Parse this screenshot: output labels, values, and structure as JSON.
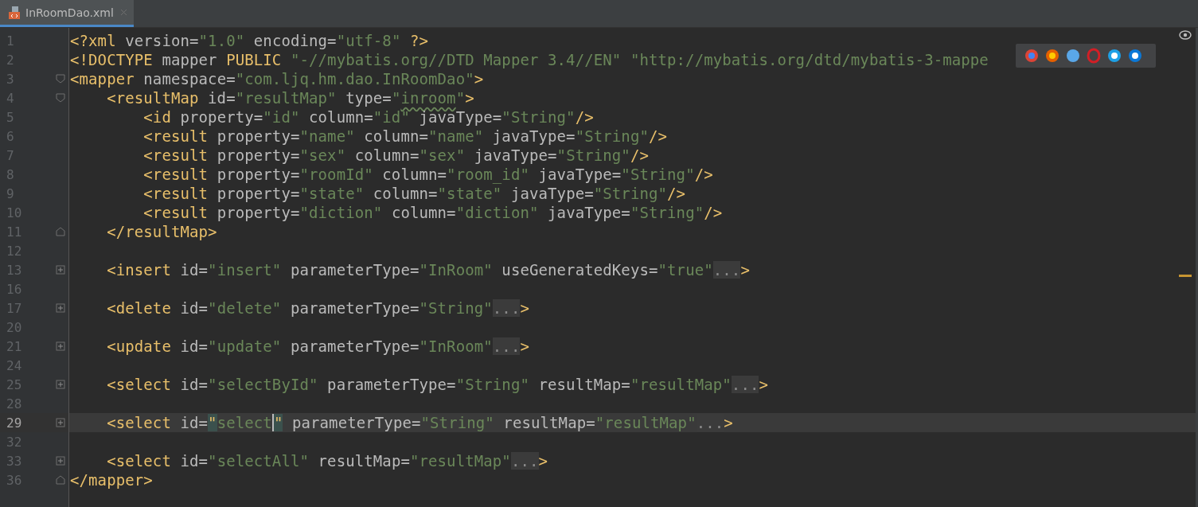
{
  "tabs": [
    {
      "label": "InRoomDao.xml",
      "selected": true
    }
  ],
  "lines": [
    {
      "number": "1",
      "kind": "plain",
      "current": false,
      "tokens": [
        {
          "kind": "tag",
          "text": "<?xml"
        },
        {
          "kind": "attr",
          "text": " version="
        },
        {
          "kind": "value",
          "text": "\"1.0\""
        },
        {
          "kind": "attr",
          "text": " encoding="
        },
        {
          "kind": "value",
          "text": "\"utf-8\""
        },
        {
          "kind": "tag",
          "text": " ?>"
        }
      ]
    },
    {
      "number": "2",
      "kind": "plain",
      "current": false,
      "tokens": [
        {
          "kind": "tag",
          "text": "<!DOCTYPE"
        },
        {
          "kind": "attr",
          "text": " mapper "
        },
        {
          "kind": "tag",
          "text": "PUBLIC"
        },
        {
          "kind": "value",
          "text": " \"-//mybatis.org//DTD Mapper 3.4//EN\" \"http://mybatis.org/dtd/mybatis-3-mappe"
        }
      ]
    },
    {
      "number": "3",
      "kind": "fold_start",
      "current": false,
      "tokens": [
        {
          "kind": "tag",
          "text": "<mapper"
        },
        {
          "kind": "attr",
          "text": " namespace="
        },
        {
          "kind": "value",
          "text": "\"com.ljq.hm.dao.InRoomDao\""
        },
        {
          "kind": "tag",
          "text": ">"
        }
      ]
    },
    {
      "number": "4",
      "kind": "fold_start",
      "current": false,
      "tokens": [
        {
          "kind": "tag",
          "text": "    <resultMap"
        },
        {
          "kind": "attr",
          "text": " id="
        },
        {
          "kind": "value",
          "text": "\"resultMap\""
        },
        {
          "kind": "attr",
          "text": " type="
        },
        {
          "kind": "value",
          "text": "\""
        },
        {
          "kind": "warning",
          "text": "inroom"
        },
        {
          "kind": "value",
          "text": "\""
        },
        {
          "kind": "tag",
          "text": ">"
        }
      ]
    },
    {
      "number": "5",
      "kind": "plain",
      "current": false,
      "tokens": [
        {
          "kind": "tag",
          "text": "        <id"
        },
        {
          "kind": "attr",
          "text": " property="
        },
        {
          "kind": "value",
          "text": "\"id\""
        },
        {
          "kind": "attr",
          "text": " column="
        },
        {
          "kind": "value",
          "text": "\"id\""
        },
        {
          "kind": "attr",
          "text": " javaType="
        },
        {
          "kind": "value",
          "text": "\"String\""
        },
        {
          "kind": "tag",
          "text": "/>"
        }
      ]
    },
    {
      "number": "6",
      "kind": "plain",
      "current": false,
      "tokens": [
        {
          "kind": "tag",
          "text": "        <result"
        },
        {
          "kind": "attr",
          "text": " property="
        },
        {
          "kind": "value",
          "text": "\"name\""
        },
        {
          "kind": "attr",
          "text": " column="
        },
        {
          "kind": "value",
          "text": "\"name\""
        },
        {
          "kind": "attr",
          "text": " javaType="
        },
        {
          "kind": "value",
          "text": "\"String\""
        },
        {
          "kind": "tag",
          "text": "/>"
        }
      ]
    },
    {
      "number": "7",
      "kind": "plain",
      "current": false,
      "tokens": [
        {
          "kind": "tag",
          "text": "        <result"
        },
        {
          "kind": "attr",
          "text": " property="
        },
        {
          "kind": "value",
          "text": "\"sex\""
        },
        {
          "kind": "attr",
          "text": " column="
        },
        {
          "kind": "value",
          "text": "\"sex\""
        },
        {
          "kind": "attr",
          "text": " javaType="
        },
        {
          "kind": "value",
          "text": "\"String\""
        },
        {
          "kind": "tag",
          "text": "/>"
        }
      ]
    },
    {
      "number": "8",
      "kind": "plain",
      "current": false,
      "tokens": [
        {
          "kind": "tag",
          "text": "        <result"
        },
        {
          "kind": "attr",
          "text": " property="
        },
        {
          "kind": "value",
          "text": "\"roomId\""
        },
        {
          "kind": "attr",
          "text": " column="
        },
        {
          "kind": "value",
          "text": "\"room_id\""
        },
        {
          "kind": "attr",
          "text": " javaType="
        },
        {
          "kind": "value",
          "text": "\"String\""
        },
        {
          "kind": "tag",
          "text": "/>"
        }
      ]
    },
    {
      "number": "9",
      "kind": "plain",
      "current": false,
      "tokens": [
        {
          "kind": "tag",
          "text": "        <result"
        },
        {
          "kind": "attr",
          "text": " property="
        },
        {
          "kind": "value",
          "text": "\"state\""
        },
        {
          "kind": "attr",
          "text": " column="
        },
        {
          "kind": "value",
          "text": "\"state\""
        },
        {
          "kind": "attr",
          "text": " javaType="
        },
        {
          "kind": "value",
          "text": "\"String\""
        },
        {
          "kind": "tag",
          "text": "/>"
        }
      ]
    },
    {
      "number": "10",
      "kind": "plain",
      "current": false,
      "tokens": [
        {
          "kind": "tag",
          "text": "        <result"
        },
        {
          "kind": "attr",
          "text": " property="
        },
        {
          "kind": "value",
          "text": "\"diction\""
        },
        {
          "kind": "attr",
          "text": " column="
        },
        {
          "kind": "value",
          "text": "\"diction\""
        },
        {
          "kind": "attr",
          "text": " javaType="
        },
        {
          "kind": "value",
          "text": "\"String\""
        },
        {
          "kind": "tag",
          "text": "/>"
        }
      ]
    },
    {
      "number": "11",
      "kind": "fold_end",
      "current": false,
      "tokens": [
        {
          "kind": "tag",
          "text": "    </resultMap>"
        }
      ]
    },
    {
      "number": "12",
      "kind": "plain",
      "current": false
    },
    {
      "number": "13",
      "kind": "collapsed",
      "current": false,
      "tokens": [
        {
          "kind": "tag",
          "text": "    <insert"
        },
        {
          "kind": "attr",
          "text": " id="
        },
        {
          "kind": "value",
          "text": "\"insert\""
        },
        {
          "kind": "attr",
          "text": " parameterType="
        },
        {
          "kind": "value",
          "text": "\"InRoom\""
        },
        {
          "kind": "attr",
          "text": " useGeneratedKeys="
        },
        {
          "kind": "value",
          "text": "\"true\""
        },
        {
          "kind": "folded",
          "text": "..."
        },
        {
          "kind": "tag",
          "text": ">"
        }
      ]
    },
    {
      "number": "16",
      "kind": "plain",
      "current": false
    },
    {
      "number": "17",
      "kind": "collapsed",
      "current": false,
      "tokens": [
        {
          "kind": "tag",
          "text": "    <delete"
        },
        {
          "kind": "attr",
          "text": " id="
        },
        {
          "kind": "value",
          "text": "\"delete\""
        },
        {
          "kind": "attr",
          "text": " parameterType="
        },
        {
          "kind": "value",
          "text": "\"String\""
        },
        {
          "kind": "folded",
          "text": "..."
        },
        {
          "kind": "tag",
          "text": ">"
        }
      ]
    },
    {
      "number": "20",
      "kind": "plain",
      "current": false
    },
    {
      "number": "21",
      "kind": "collapsed",
      "current": false,
      "tokens": [
        {
          "kind": "tag",
          "text": "    <update"
        },
        {
          "kind": "attr",
          "text": " id="
        },
        {
          "kind": "value",
          "text": "\"update\""
        },
        {
          "kind": "attr",
          "text": " parameterType="
        },
        {
          "kind": "value",
          "text": "\"InRoom\""
        },
        {
          "kind": "folded",
          "text": "..."
        },
        {
          "kind": "tag",
          "text": ">"
        }
      ]
    },
    {
      "number": "24",
      "kind": "plain",
      "current": false
    },
    {
      "number": "25",
      "kind": "collapsed",
      "current": false,
      "tokens": [
        {
          "kind": "tag",
          "text": "    <select"
        },
        {
          "kind": "attr",
          "text": " id="
        },
        {
          "kind": "value",
          "text": "\"selectById\""
        },
        {
          "kind": "attr",
          "text": " parameterType="
        },
        {
          "kind": "value",
          "text": "\"String\""
        },
        {
          "kind": "attr",
          "text": " resultMap="
        },
        {
          "kind": "value",
          "text": "\"resultMap\""
        },
        {
          "kind": "folded",
          "text": "..."
        },
        {
          "kind": "tag",
          "text": ">"
        }
      ]
    },
    {
      "number": "28",
      "kind": "plain",
      "current": false
    },
    {
      "number": "29",
      "kind": "collapsed",
      "current": true,
      "tokens": [
        {
          "kind": "tag",
          "text": "    <select"
        },
        {
          "kind": "attr",
          "text": " id="
        },
        {
          "kind": "match",
          "text": "\""
        },
        {
          "kind": "value",
          "text": "select"
        },
        {
          "kind": "caret",
          "text": "\""
        },
        {
          "kind": "attr",
          "text": " parameterType="
        },
        {
          "kind": "value",
          "text": "\"String\""
        },
        {
          "kind": "attr",
          "text": " resultMap="
        },
        {
          "kind": "value",
          "text": "\"resultMap\""
        },
        {
          "kind": "folded",
          "text": "..."
        },
        {
          "kind": "tag",
          "text": ">"
        }
      ]
    },
    {
      "number": "32",
      "kind": "plain",
      "current": false
    },
    {
      "number": "33",
      "kind": "collapsed",
      "current": false,
      "tokens": [
        {
          "kind": "tag",
          "text": "    <select"
        },
        {
          "kind": "attr",
          "text": " id="
        },
        {
          "kind": "value",
          "text": "\"selectAll\""
        },
        {
          "kind": "attr",
          "text": " resultMap="
        },
        {
          "kind": "value",
          "text": "\"resultMap\""
        },
        {
          "kind": "folded",
          "text": "..."
        },
        {
          "kind": "tag",
          "text": ">"
        }
      ]
    },
    {
      "number": "36",
      "kind": "fold_end",
      "current": false,
      "tokens": [
        {
          "kind": "tag",
          "text": "</mapper>"
        }
      ]
    }
  ]
}
